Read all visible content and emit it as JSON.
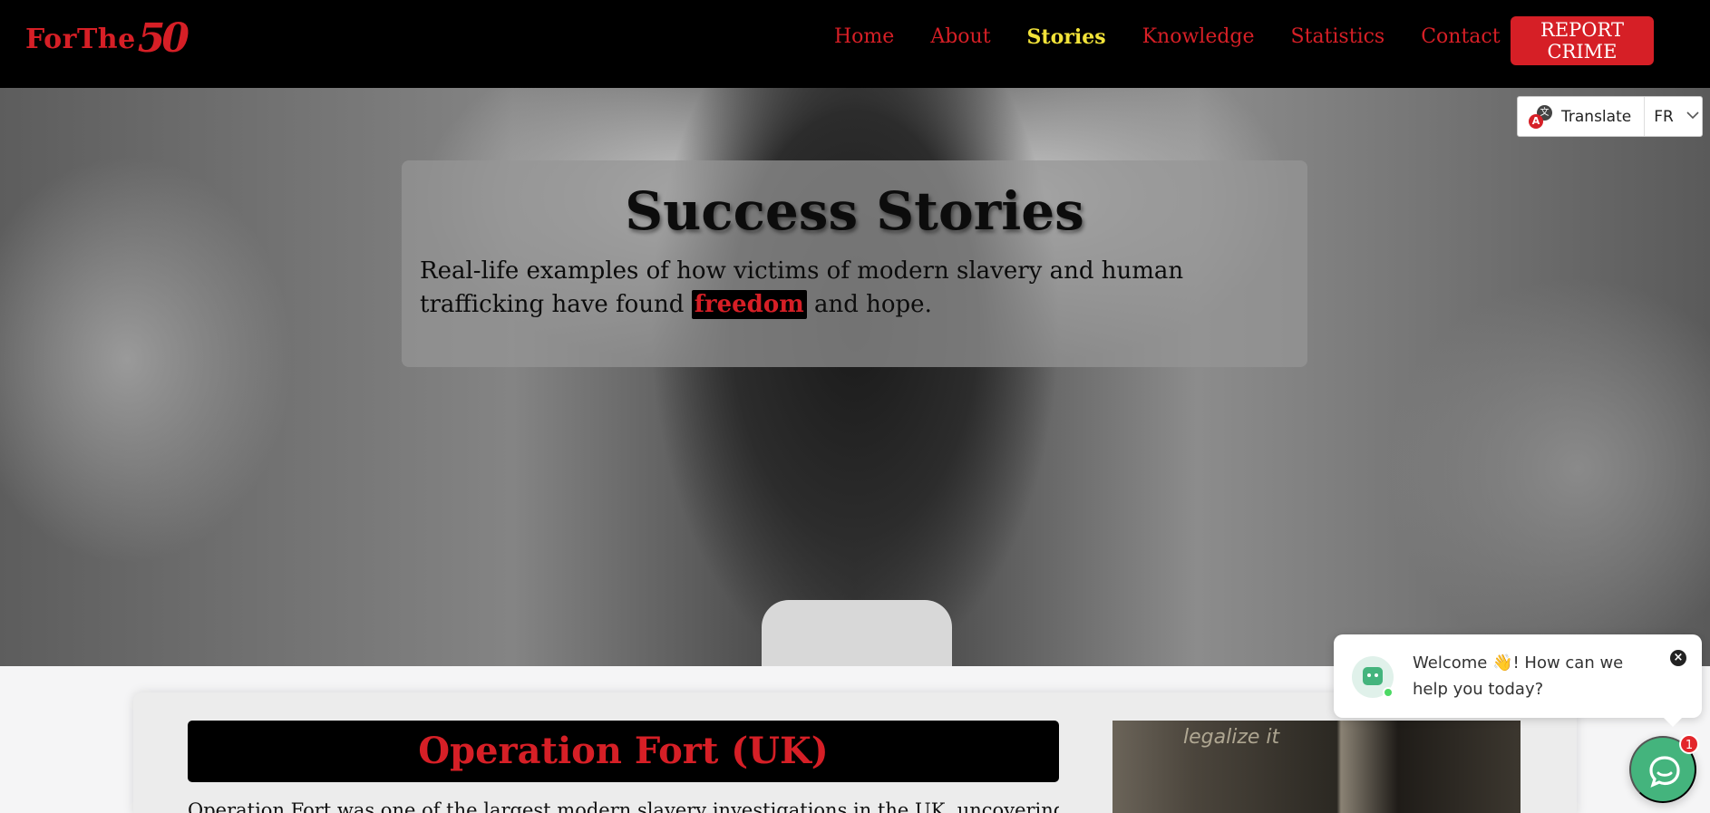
{
  "brand": {
    "name": "ForThe",
    "number": "50"
  },
  "nav": {
    "items": [
      {
        "label": "Home",
        "active": false
      },
      {
        "label": "About",
        "active": false
      },
      {
        "label": "Stories",
        "active": true
      },
      {
        "label": "Knowledge",
        "active": false
      },
      {
        "label": "Statistics",
        "active": false
      },
      {
        "label": "Contact",
        "active": false
      }
    ],
    "report_button": "REPORT CRIME"
  },
  "translate": {
    "label": "Translate",
    "language": "FR",
    "icon_letter": "A",
    "icon_glyph": "文"
  },
  "hero": {
    "title": "Success Stories",
    "subtitle_before": "Real-life examples of how victims of modern slavery and human trafficking have found",
    "subtitle_highlight": "freedom",
    "subtitle_after": "and hope."
  },
  "story": {
    "title": "Operation Fort (UK)",
    "text": "Operation Fort was one of the largest modern slavery investigations in the UK, uncovering a",
    "image_graffiti": "legalize it"
  },
  "chat": {
    "welcome": "Welcome 👋! How can we help you today?",
    "close_glyph": "×",
    "badge_count": "1"
  },
  "colors": {
    "brand_red": "#d61f26",
    "active_yellow": "#f2e339",
    "chat_green": "#44b47d"
  }
}
